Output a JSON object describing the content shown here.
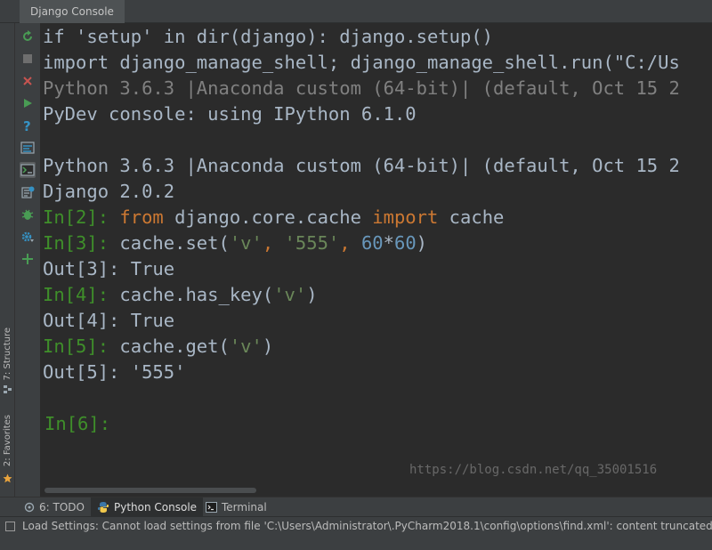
{
  "window": {
    "tab_title": "Django Console"
  },
  "left_strip": {
    "structure_label": "7: Structure",
    "favorites_label": "2: Favorites"
  },
  "toolbar": {
    "icons": [
      "rerun-icon",
      "stop-icon",
      "close-icon",
      "run-icon",
      "help-icon",
      "variables-icon",
      "console-icon",
      "history-icon",
      "debug-icon",
      "settings-icon",
      "add-icon"
    ]
  },
  "console": {
    "lines": [
      "if 'setup' in dir(django): django.setup()",
      "import django_manage_shell; django_manage_shell.run(\"C:/Us",
      "Python 3.6.3 |Anaconda custom (64-bit)| (default, Oct 15 2",
      "PyDev console: using IPython 6.1.0",
      "Python 3.6.3 |Anaconda custom (64-bit)| (default, Oct 15 2",
      "Django 2.0.2",
      "Out[3]: True",
      "Out[4]: True",
      "Out[5]: '555'"
    ],
    "in2": {
      "prompt": "In[2]: ",
      "kw1": "from",
      "mod": " django.core.cache ",
      "kw2": "import",
      "name": " cache"
    },
    "in3": {
      "prompt": "In[3]: ",
      "pre": "cache.set(",
      "s1": "'v'",
      "comma1": ", ",
      "s2": "'555'",
      "comma2": ", ",
      "n1": "60",
      "op": "*",
      "n2": "60",
      "post": ")"
    },
    "in4": {
      "prompt": "In[4]: ",
      "pre": "cache.has_key(",
      "s1": "'v'",
      "post": ")"
    },
    "in5": {
      "prompt": "In[5]: ",
      "pre": "cache.get(",
      "s1": "'v'",
      "post": ")"
    },
    "in6": {
      "prompt": "In[6]:"
    },
    "watermark": "https://blog.csdn.net/qq_35001516"
  },
  "bottom_tabs": [
    {
      "label": "6: TODO",
      "icon": "todo-icon"
    },
    {
      "label": "Python Console",
      "icon": "python-icon"
    },
    {
      "label": "Terminal",
      "icon": "terminal-icon"
    }
  ],
  "status": {
    "text": "Load Settings: Cannot load settings from file 'C:\\Users\\Administrator\\.PyCharm2018.1\\config\\options\\find.xml': content truncated // Fi"
  },
  "colors": {
    "background": "#2b2b2b",
    "text": "#a9b7c6",
    "prompt": "#3f8f2a",
    "keyword": "#cc7832",
    "string": "#6a8759",
    "number": "#6897bb"
  }
}
